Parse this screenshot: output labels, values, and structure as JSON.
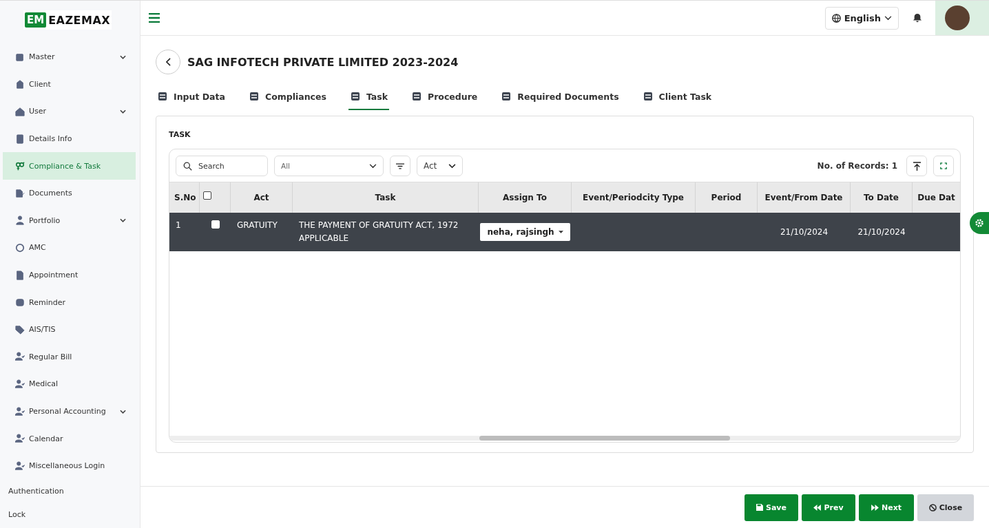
{
  "logo": {
    "mark": "EM",
    "text": "EAZEMAX"
  },
  "sidebar": {
    "items": [
      {
        "label": "Master",
        "expandable": true,
        "selected": false
      },
      {
        "label": "Client",
        "expandable": false,
        "selected": false
      },
      {
        "label": "User",
        "expandable": true,
        "selected": false
      },
      {
        "label": "Details Info",
        "expandable": false,
        "selected": false
      },
      {
        "label": "Compliance & Task",
        "expandable": false,
        "selected": true
      },
      {
        "label": "Documents",
        "expandable": false,
        "selected": false
      },
      {
        "label": "Portfolio",
        "expandable": true,
        "selected": false
      },
      {
        "label": "AMC",
        "expandable": false,
        "selected": false
      },
      {
        "label": "Appointment",
        "expandable": false,
        "selected": false
      },
      {
        "label": "Reminder",
        "expandable": false,
        "selected": false
      },
      {
        "label": "AIS/TIS",
        "expandable": false,
        "selected": false
      },
      {
        "label": "Regular Bill",
        "expandable": false,
        "selected": false
      },
      {
        "label": "Medical",
        "expandable": false,
        "selected": false
      },
      {
        "label": "Personal Accounting",
        "expandable": true,
        "selected": false
      },
      {
        "label": "Calendar",
        "expandable": false,
        "selected": false
      },
      {
        "label": "Miscellaneous Login",
        "expandable": false,
        "selected": false
      }
    ],
    "footer_links": [
      "Authentication",
      "Lock"
    ]
  },
  "topbar": {
    "language": "English"
  },
  "page": {
    "title": "SAG INFOTECH PRIVATE LIMITED 2023-2024"
  },
  "tabs": [
    {
      "label": "Input Data",
      "selected": false
    },
    {
      "label": "Compliances",
      "selected": false
    },
    {
      "label": "Task",
      "selected": true
    },
    {
      "label": "Procedure",
      "selected": false
    },
    {
      "label": "Required Documents",
      "selected": false
    },
    {
      "label": "Client Task",
      "selected": false
    }
  ],
  "section_title": "TASK",
  "toolbar": {
    "search_placeholder": "Search",
    "filter_value": "All",
    "act_value": "Act",
    "records": "No. of Records: 1"
  },
  "table": {
    "columns": [
      "S.No",
      "",
      "Act",
      "Task",
      "Assign To",
      "Event/Periodcity Type",
      "Period",
      "Event/From Date",
      "To Date",
      "Due Dat"
    ],
    "header_checked": false,
    "rows": [
      {
        "sno": "1",
        "checked": false,
        "selected": true,
        "act": "GRATUITY",
        "task": "THE PAYMENT OF GRATUITY ACT, 1972 APPLICABLE",
        "assign_to": "neha, rajsingh",
        "event_type": "",
        "period": "",
        "from_date": "21/10/2024",
        "to_date": "21/10/2024",
        "due_date": ""
      }
    ]
  },
  "buttons": [
    {
      "label": "Save",
      "kind": "save"
    },
    {
      "label": "Prev",
      "kind": "prev"
    },
    {
      "label": "Next",
      "kind": "next"
    },
    {
      "label": "Close",
      "kind": "close"
    }
  ]
}
